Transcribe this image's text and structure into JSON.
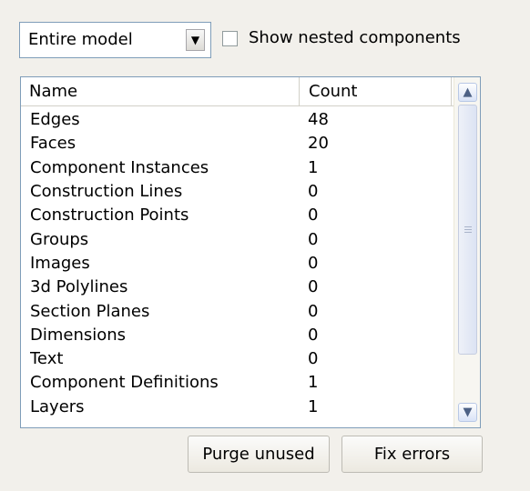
{
  "scope": {
    "selected": "Entire model"
  },
  "nested": {
    "label": "Show nested components",
    "checked": false
  },
  "table": {
    "columns": {
      "name": "Name",
      "count": "Count"
    },
    "rows": [
      {
        "name": "Edges",
        "count": "48"
      },
      {
        "name": "Faces",
        "count": "20"
      },
      {
        "name": "Component Instances",
        "count": "1"
      },
      {
        "name": "Construction Lines",
        "count": "0"
      },
      {
        "name": "Construction Points",
        "count": "0"
      },
      {
        "name": "Groups",
        "count": "0"
      },
      {
        "name": "Images",
        "count": "0"
      },
      {
        "name": "3d Polylines",
        "count": "0"
      },
      {
        "name": "Section Planes",
        "count": "0"
      },
      {
        "name": "Dimensions",
        "count": "0"
      },
      {
        "name": "Text",
        "count": "0"
      },
      {
        "name": "Component Definitions",
        "count": "1"
      },
      {
        "name": "Layers",
        "count": "1"
      }
    ]
  },
  "buttons": {
    "purge": "Purge unused",
    "fix": "Fix errors"
  },
  "icons": {
    "dropdown": "chevron-down-icon",
    "scroll_up": "arrow-up-icon",
    "scroll_down": "arrow-down-icon",
    "thumb_grip": "scroll-grip-icon"
  }
}
